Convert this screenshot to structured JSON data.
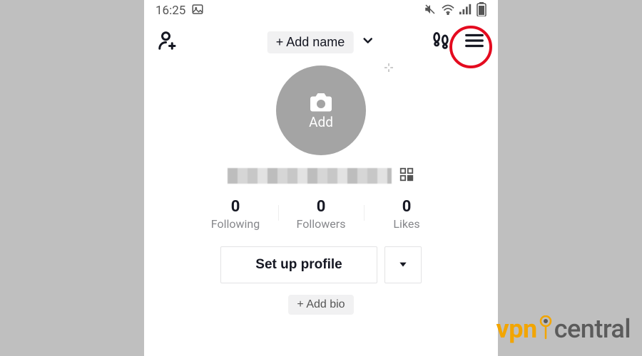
{
  "statusbar": {
    "time": "16:25"
  },
  "header": {
    "add_name_label": "+ Add name"
  },
  "avatar": {
    "add_label": "Add"
  },
  "stats": {
    "following": {
      "value": "0",
      "label": "Following"
    },
    "followers": {
      "value": "0",
      "label": "Followers"
    },
    "likes": {
      "value": "0",
      "label": "Likes"
    }
  },
  "actions": {
    "setup_profile_label": "Set up profile",
    "add_bio_label": "+ Add bio"
  },
  "watermark": {
    "part1": "vpn",
    "part2": "central"
  }
}
